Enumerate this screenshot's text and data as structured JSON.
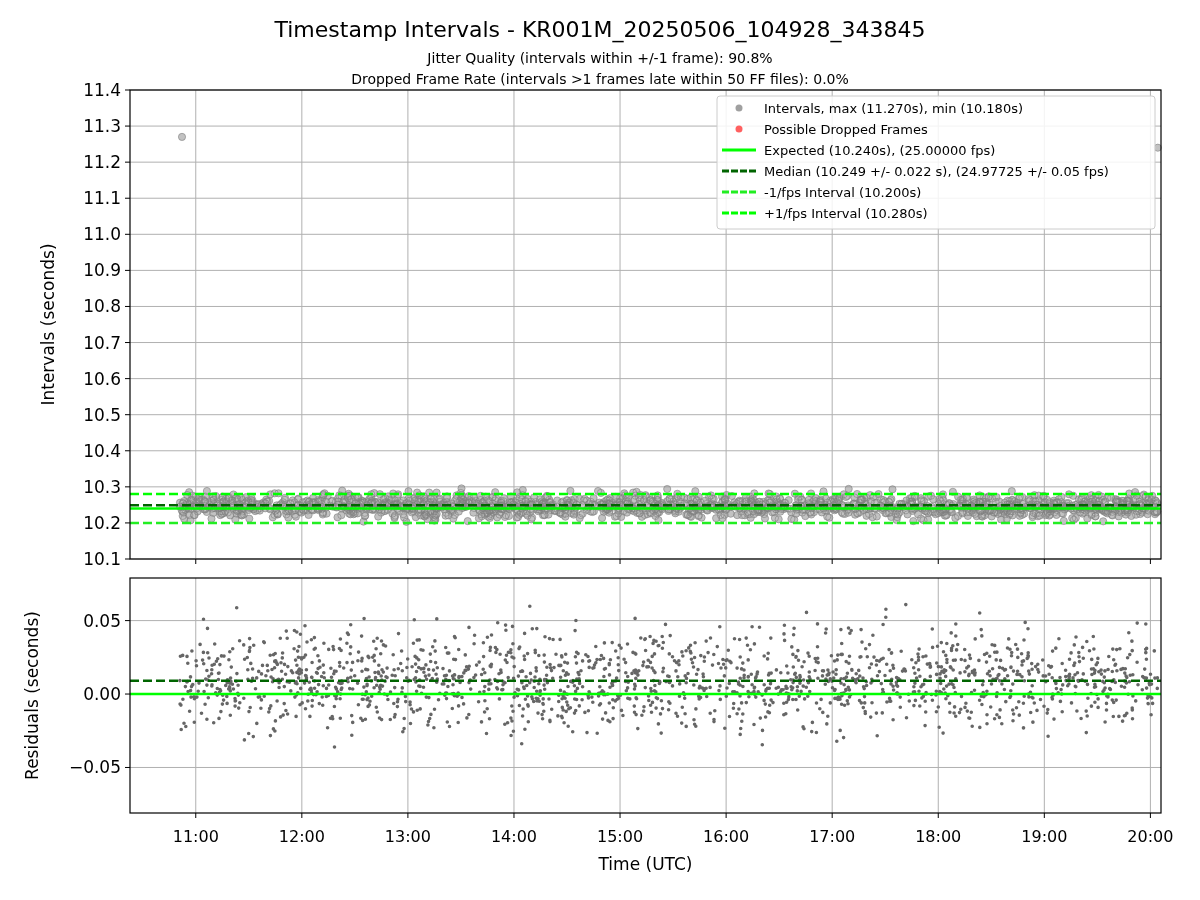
{
  "figure": {
    "title": "Timestamp Intervals - KR001M_20250506_104928_343845",
    "subtitles": [
      "Jitter Quality (intervals within +/-1 frame): 90.8%",
      "Dropped Frame Rate (intervals >1 frames late within 50 FF files): 0.0%"
    ]
  },
  "intervals_panel": {
    "legend": [
      {
        "kind": "marker",
        "color": "#a0a0a0",
        "label": "Intervals, max (11.270s), min (10.180s)"
      },
      {
        "kind": "marker",
        "color": "#ff6060",
        "label": "Possible Dropped Frames"
      },
      {
        "kind": "line",
        "color": "#00ff00",
        "label": "Expected (10.240s), (25.00000 fps)"
      },
      {
        "kind": "dashed",
        "color": "#006400",
        "label": "Median (10.249 +/- 0.022 s), (24.97725 +/- 0.05 fps)"
      },
      {
        "kind": "dashed",
        "color": "#22ee22",
        "label": "-1/fps Interval (10.200s)"
      },
      {
        "kind": "dashed",
        "color": "#00ff00",
        "label": "+1/fps Interval (10.280s)"
      }
    ],
    "chart_data": {
      "type": "line",
      "ylabel": "Intervals (seconds)",
      "grid": true,
      "x": [
        10.38,
        20.1
      ],
      "xlim": [
        10.38,
        20.1
      ],
      "ylim": [
        10.1,
        11.4
      ],
      "yticks": [
        {
          "value": 10.1,
          "label": "10.1"
        },
        {
          "value": 10.2,
          "label": "10.2"
        },
        {
          "value": 10.3,
          "label": "10.3"
        },
        {
          "value": 10.4,
          "label": "10.4"
        },
        {
          "value": 10.5,
          "label": "10.5"
        },
        {
          "value": 10.6,
          "label": "10.6"
        },
        {
          "value": 10.7,
          "label": "10.7"
        },
        {
          "value": 10.8,
          "label": "10.8"
        },
        {
          "value": 10.9,
          "label": "10.9"
        },
        {
          "value": 11.0,
          "label": "11.0"
        },
        {
          "value": 11.1,
          "label": "11.1"
        },
        {
          "value": 11.2,
          "label": "11.2"
        },
        {
          "value": 11.3,
          "label": "11.3"
        },
        {
          "value": 11.4,
          "label": "11.4"
        }
      ],
      "series": [
        {
          "color": "#00ff00",
          "line_style": "solid",
          "values": [
            10.24,
            10.24
          ]
        },
        {
          "color": "#006400",
          "line_style": "dashed",
          "values": [
            10.249,
            10.249
          ]
        },
        {
          "color": "#22ee22",
          "line_style": "dashed",
          "values": [
            10.2,
            10.2
          ]
        },
        {
          "color": "#00ff00",
          "line_style": "dashed",
          "values": [
            10.28,
            10.28
          ]
        }
      ]
    }
  },
  "residuals_panel": {
    "chart_data": {
      "type": "line",
      "xlabel": "Time (UTC)",
      "ylabel": "Residuals (seconds)",
      "grid": true,
      "x": [
        10.38,
        20.1
      ],
      "xlim": [
        10.38,
        20.1
      ],
      "ylim": [
        -0.081,
        0.079
      ],
      "xticks": [
        {
          "value": 11,
          "label": "11:00"
        },
        {
          "value": 12,
          "label": "12:00"
        },
        {
          "value": 13,
          "label": "13:00"
        },
        {
          "value": 14,
          "label": "14:00"
        },
        {
          "value": 15,
          "label": "15:00"
        },
        {
          "value": 16,
          "label": "16:00"
        },
        {
          "value": 17,
          "label": "17:00"
        },
        {
          "value": 18,
          "label": "18:00"
        },
        {
          "value": 19,
          "label": "19:00"
        },
        {
          "value": 20,
          "label": "20:00"
        }
      ],
      "yticks": [
        {
          "value": -0.05,
          "label": "−0.05"
        },
        {
          "value": 0,
          "label": "0.00"
        },
        {
          "value": 0.05,
          "label": "0.05"
        }
      ],
      "series": [
        {
          "color": "#00ff00",
          "line_style": "solid",
          "values": [
            0,
            0
          ]
        },
        {
          "color": "#006400",
          "line_style": "dashed",
          "values": [
            0.009,
            0.009
          ]
        }
      ]
    }
  }
}
